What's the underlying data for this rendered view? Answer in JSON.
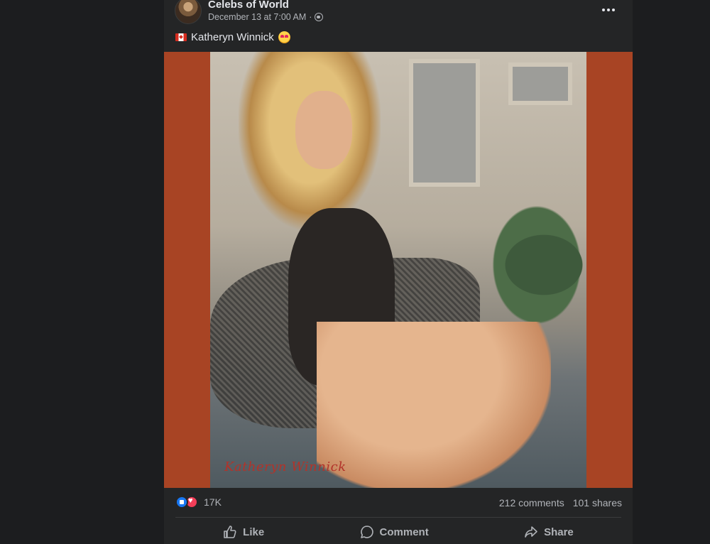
{
  "post": {
    "author": "Celebs of World",
    "timestamp": "December 13 at 7:00 AM",
    "separator": "·",
    "caption": "Katheryn Winnick",
    "photo_watermark": "Katheryn Winnick"
  },
  "engagement": {
    "reaction_count": "17K",
    "comments": "212 comments",
    "shares": "101 shares"
  },
  "actions": {
    "like": "Like",
    "comment": "Comment",
    "share": "Share"
  },
  "colors": {
    "background": "#1b1c1e",
    "card": "#242526",
    "photo_border": "#a84424",
    "like_blue": "#1877f2",
    "love_red": "#f33e58"
  },
  "icons": [
    "globe-icon",
    "more-options-icon",
    "canada-flag-icon",
    "heart-eyes-emoji-icon",
    "like-reaction-icon",
    "love-reaction-icon",
    "thumbs-up-icon",
    "comment-icon",
    "share-icon"
  ]
}
